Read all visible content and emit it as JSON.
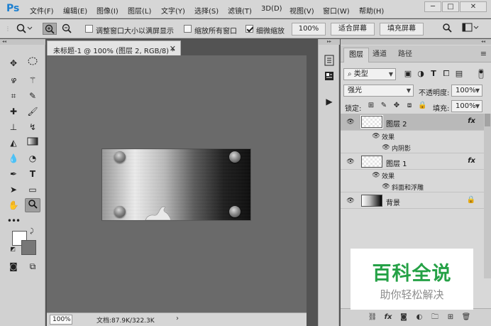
{
  "app": {
    "logo": "Ps"
  },
  "menu": [
    "文件(F)",
    "编辑(E)",
    "图像(I)",
    "图层(L)",
    "文字(Y)",
    "选择(S)",
    "滤镜(T)",
    "3D(D)",
    "视图(V)",
    "窗口(W)",
    "帮助(H)"
  ],
  "window_controls": {
    "minimize": "─",
    "restore": "□",
    "close": "✕"
  },
  "options": {
    "resize_windows_label": "调整窗口大小以满屏显示",
    "resize_windows_checked": false,
    "zoom_all_label": "缩放所有窗口",
    "zoom_all_checked": false,
    "scrubby_zoom_label": "细微缩放",
    "scrubby_zoom_checked": true,
    "zoom_100_label": "100%",
    "fit_screen_label": "适合屏幕",
    "fill_screen_label": "填充屏幕"
  },
  "document": {
    "tab_title": "未标题-1 @ 100% (图层 2, RGB/8) *",
    "zoom_value": "100%",
    "doc_info": "文档:87.9K/322.3K"
  },
  "layers_panel": {
    "tabs": [
      "图层",
      "通道",
      "路径"
    ],
    "filter_kind": "类型",
    "blend_mode": "强光",
    "opacity_label": "不透明度:",
    "opacity_value": "100%",
    "lock_label": "锁定:",
    "fill_label": "填充:",
    "fill_value": "100%",
    "layers": [
      {
        "name": "图层 2",
        "selected": true,
        "effects_label": "效果",
        "effect": "内阴影",
        "fx": "fx"
      },
      {
        "name": "图层 1",
        "selected": false,
        "effects_label": "效果",
        "effect": "斜面和浮雕",
        "fx": "fx"
      },
      {
        "name": "背景",
        "selected": false,
        "locked": true
      }
    ]
  },
  "watermark": {
    "title": "百科全说",
    "subtitle": "助你轻松解决"
  },
  "colors": {
    "accent": "#1c7fd0",
    "watermark_green": "#25a146",
    "workspace": "#6a6a6a"
  }
}
